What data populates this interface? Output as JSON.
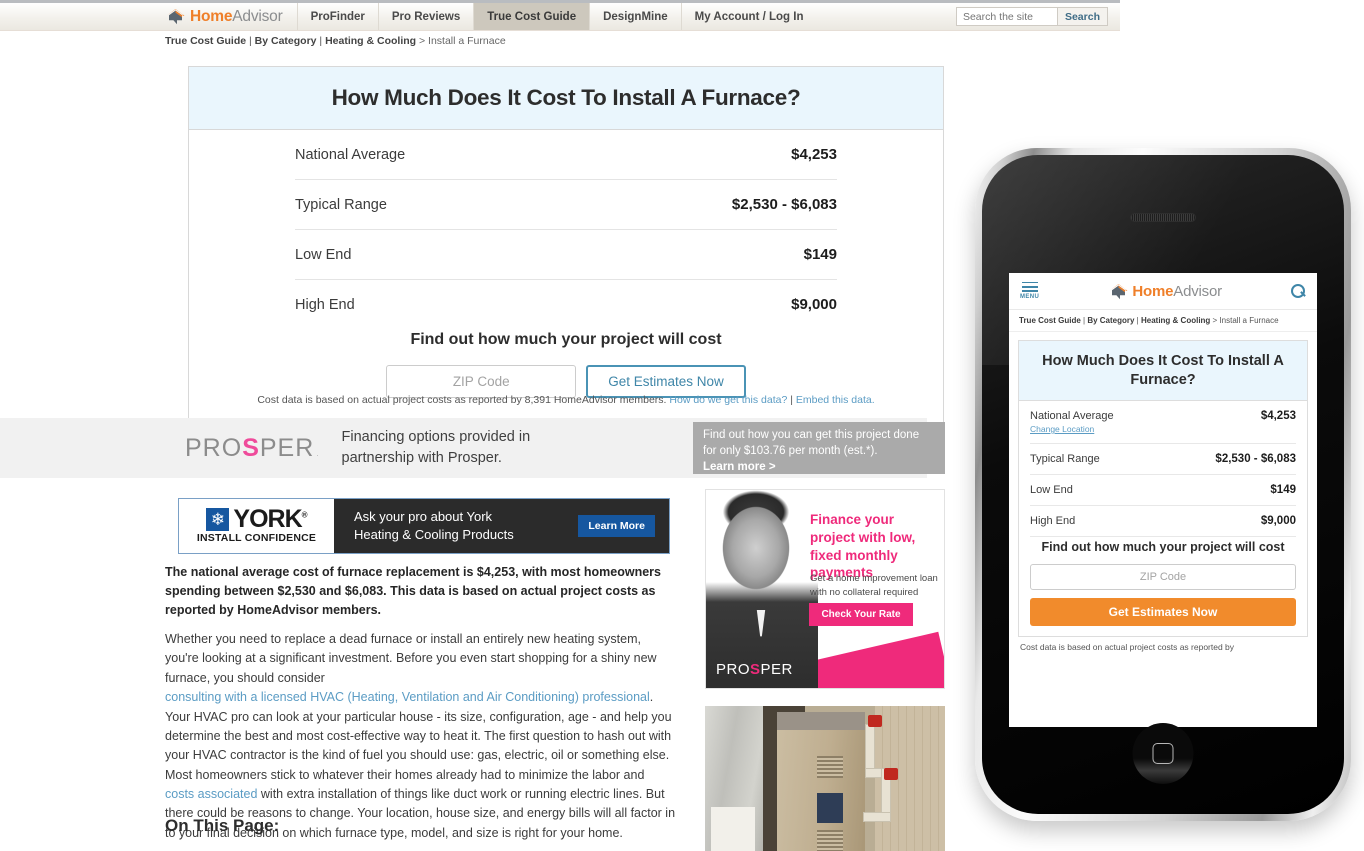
{
  "nav": {
    "logo": {
      "bold": "Home",
      "light": "Advisor",
      "icon": "house-chat-icon"
    },
    "items": [
      {
        "label": "ProFinder",
        "active": false
      },
      {
        "label": "Pro Reviews",
        "active": false
      },
      {
        "label": "True Cost Guide",
        "active": true
      },
      {
        "label": "DesignMine",
        "active": false
      },
      {
        "label": "My Account / Log In",
        "active": false
      }
    ],
    "search": {
      "placeholder": "Search the site",
      "value": "",
      "button": "Search"
    }
  },
  "breadcrumb": {
    "part1": "True Cost Guide",
    "sep1": " | ",
    "part2": "By Category",
    "sep2": " | ",
    "part3": "Heating & Cooling",
    "tail": " > Install a Furnace"
  },
  "cost_card": {
    "title": "How Much Does It Cost To Install A Furnace?",
    "rows": [
      {
        "label": "National Average",
        "value": "$4,253"
      },
      {
        "label": "Typical Range",
        "value": "$2,530 - $6,083"
      },
      {
        "label": "Low End",
        "value": "$149"
      },
      {
        "label": "High End",
        "value": "$9,000"
      }
    ],
    "cta_title": "Find out how much your project will cost",
    "zip_placeholder": "ZIP Code",
    "zip_value": "",
    "estimates_button": "Get Estimates Now",
    "note_text": "Cost data is based on actual project costs as reported by 8,391 HomeAdvisor members. ",
    "note_link1": "How do we get this data?",
    "note_sep": " | ",
    "note_link2": "Embed this data."
  },
  "prosper_strip": {
    "logo_pre": "PRO",
    "logo_dot": "S",
    "logo_post": "PER",
    "logo_tm": ".",
    "copy": "Financing options provided in partnership with Prosper."
  },
  "gray_promo": {
    "line1": "Find out how you can get this project",
    "line2": "done for only $103.76 per month (est.*).",
    "learn_more": "Learn more >"
  },
  "york_ad": {
    "flake_icon": "snowflake-icon",
    "brand": "YORK",
    "registered": "®",
    "tagline": "INSTALL CONFIDENCE",
    "copy_line1": "Ask your pro about York",
    "copy_line2": "Heating & Cooling Products",
    "cta": "Learn More"
  },
  "article": {
    "lead": "The national average cost of furnace replacement is $4,253, with most homeowners spending between $2,530 and $6,083. This data is based on actual project costs as reported by HomeAdvisor members.",
    "para_a": " Whether you need to replace a dead furnace or install an entirely new heating system, you're looking at a significant investment. Before you even start shopping for a shiny new furnace, you should consider",
    "link1": "consulting with a licensed HVAC (Heating, Ventilation and Air Conditioning) professional",
    "para_b": ". Your HVAC pro can look at your particular house - its size, configuration, age - and help you determine the best and most cost-effective way to heat it. The first question to hash out with your HVAC contractor is the kind of fuel you should use: gas, electric, oil or something else. Most homeowners stick to whatever their homes already had to minimize the labor and ",
    "link2": "costs associated",
    "para_c": " with extra installation of things like duct work or running electric lines. But there could be reasons to change. Your location, house size, and energy bills will all factor in to your final decision on which furnace type, model, and size is right for your home.",
    "on_this_page": "On This Page:"
  },
  "prosper_ad": {
    "headline": "Finance your project with low, fixed monthly payments",
    "subtext": "Get a home improvement loan with no collateral required",
    "cta": "Check Your Rate",
    "logo_pre": "PRO",
    "logo_dot": "S",
    "logo_post": "PER"
  },
  "furnace_photo": {
    "alt": "furnace-installation-photo"
  },
  "phone": {
    "device": "smartphone-mockup",
    "header": {
      "menu_label": "MENU",
      "menu_icon": "hamburger-icon",
      "logo_bold": "Home",
      "logo_light": "Advisor",
      "search_icon": "search-icon"
    },
    "breadcrumb": {
      "part1": "True Cost Guide",
      "sep1": " | ",
      "part2": "By Category",
      "sep2": " | ",
      "part3": "Heating & Cooling",
      "tail": " > Install a Furnace"
    },
    "card": {
      "title": "How Much Does It Cost To Install A Furnace?",
      "rows": [
        {
          "label": "National Average",
          "value": "$4,253",
          "sublink": "Change Location"
        },
        {
          "label": "Typical Range",
          "value": "$2,530 - $6,083"
        },
        {
          "label": "Low End",
          "value": "$149"
        },
        {
          "label": "High End",
          "value": "$9,000"
        }
      ],
      "cta_title": "Find out how much your project will cost",
      "zip_placeholder": "ZIP Code",
      "zip_value": "",
      "estimates_button": "Get Estimates Now",
      "note": "Cost data is based on actual project costs as reported by"
    }
  },
  "colors": {
    "brand_orange": "#ef7f29",
    "card_head_blue": "#eaf6fd",
    "link_blue": "#5b9cc4",
    "cta_blue": "#4a93b5",
    "mobile_cta_orange": "#f18b2c",
    "prosper_pink": "#ef2a7b",
    "york_blue": "#1657a0",
    "nav_active": "#cdc8bd"
  }
}
